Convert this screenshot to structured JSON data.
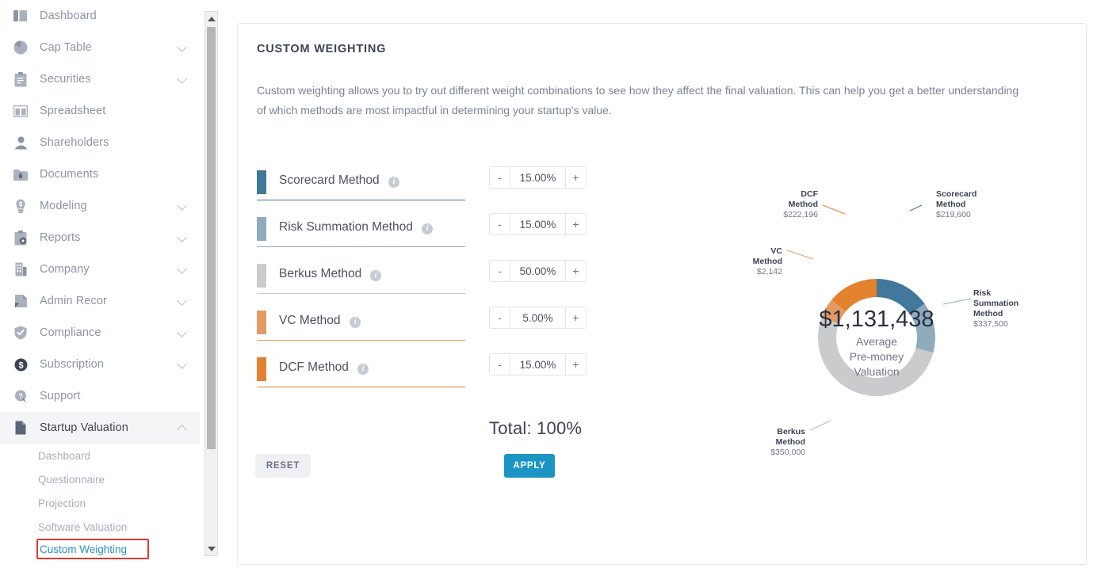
{
  "sidebar": {
    "items": [
      {
        "label": "Dashboard",
        "icon": "dashboard-icon",
        "expandable": false,
        "active": false
      },
      {
        "label": "Cap Table",
        "icon": "pie-chart-icon",
        "expandable": true,
        "active": false
      },
      {
        "label": "Securities",
        "icon": "clipboard-icon",
        "expandable": true,
        "active": false
      },
      {
        "label": "Spreadsheet",
        "icon": "spreadsheet-icon",
        "expandable": false,
        "active": false
      },
      {
        "label": "Shareholders",
        "icon": "user-icon",
        "expandable": false,
        "active": false
      },
      {
        "label": "Documents",
        "icon": "folder-lock-icon",
        "expandable": false,
        "active": false
      },
      {
        "label": "Modeling",
        "icon": "lightbulb-dollar-icon",
        "expandable": true,
        "active": false
      },
      {
        "label": "Reports",
        "icon": "report-gear-icon",
        "expandable": true,
        "active": false
      },
      {
        "label": "Company",
        "icon": "building-icon",
        "expandable": true,
        "active": false
      },
      {
        "label": "Admin Recor",
        "icon": "admin-folder-icon",
        "expandable": true,
        "active": false
      },
      {
        "label": "Compliance",
        "icon": "shield-check-icon",
        "expandable": true,
        "active": false
      },
      {
        "label": "Subscription",
        "icon": "dollar-circle-icon",
        "expandable": true,
        "active": false
      },
      {
        "label": "Support",
        "icon": "question-bubble-icon",
        "expandable": false,
        "active": false
      },
      {
        "label": "Startup Valuation",
        "icon": "document-icon",
        "expandable": true,
        "active": true
      }
    ],
    "sub_items": [
      {
        "label": "Dashboard",
        "selected": false
      },
      {
        "label": "Questionnaire",
        "selected": false
      },
      {
        "label": "Projection",
        "selected": false
      },
      {
        "label": "Software Valuation",
        "selected": false
      },
      {
        "label": "Custom Weighting",
        "selected": true
      }
    ]
  },
  "panel": {
    "title": "CUSTOM WEIGHTING",
    "description": "Custom weighting allows you to try out different weight combinations to see how they affect the final valuation. This can help you get a better understanding of which methods are most impactful in determining your startup's value.",
    "total_label": "Total: 100%",
    "reset_label": "RESET",
    "apply_label": "APPLY",
    "info_icon": "info-icon",
    "minus_label": "-",
    "plus_label": "+"
  },
  "methods": [
    {
      "name": "Scorecard Method",
      "weight": "15.00%",
      "color": "#41789b"
    },
    {
      "name": "Risk Summation Method",
      "weight": "15.00%",
      "color": "#8fabbd"
    },
    {
      "name": "Berkus Method",
      "weight": "50.00%",
      "color": "#c9cbcc"
    },
    {
      "name": "VC Method",
      "weight": "5.00%",
      "color": "#e49a63"
    },
    {
      "name": "DCF Method",
      "weight": "15.00%",
      "color": "#e2822f"
    }
  ],
  "chart_data": {
    "type": "pie",
    "title": "",
    "center_value": "$1,131,438",
    "center_label_lines": [
      "Average",
      "Pre-money",
      "Valuation"
    ],
    "legend_position": "callout-labels",
    "categories": [
      "Scorecard Method",
      "Risk Summation Method",
      "Berkus Method",
      "VC Method",
      "DCF Method"
    ],
    "values": [
      219600,
      337500,
      350000,
      2142,
      222196
    ],
    "value_labels": [
      "$219,600",
      "$337,500",
      "$350,000",
      "$2,142",
      "$222,196"
    ],
    "colors": [
      "#41789b",
      "#8fabbd",
      "#c9cbcc",
      "#e49a63",
      "#e2822f"
    ],
    "segment_degrees": [
      55,
      50,
      185,
      20,
      50
    ],
    "slices": [
      {
        "name_lines": [
          "Scorecard",
          "Method"
        ],
        "value": "$219,600",
        "color": "#41789b"
      },
      {
        "name_lines": [
          "Risk",
          "Summation",
          "Method"
        ],
        "value": "$337,500",
        "color": "#8fabbd"
      },
      {
        "name_lines": [
          "Berkus",
          "Method"
        ],
        "value": "$350,000",
        "color": "#c9cbcc"
      },
      {
        "name_lines": [
          "VC",
          "Method"
        ],
        "value": "$2,142",
        "color": "#e49a63"
      },
      {
        "name_lines": [
          "DCF",
          "Method"
        ],
        "value": "$222,196",
        "color": "#e2822f"
      }
    ]
  },
  "scrollbar": {
    "up_icon": "scroll-up-arrow-icon",
    "down_icon": "scroll-down-arrow-icon"
  }
}
